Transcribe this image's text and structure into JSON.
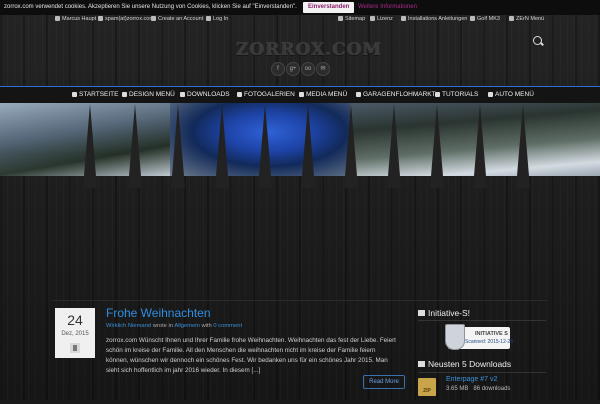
{
  "cookie": {
    "message": "zorrox.com verwendet cookies. Akzeptieren Sie unsere Nutzung von Cookies, klicken Sie auf \"Einverstanden\".",
    "accept_label": "Einverstanden",
    "more_label": "Weitere Informationen"
  },
  "topbar": {
    "user": "Marcus Haupt",
    "email": "spam(at)zorrox.com",
    "create_account": "Create an Account",
    "login": "Log In",
    "sitemap": "Sitemap",
    "license": "Lizenz",
    "install": "Installations Anleitungen",
    "golf": "Golf MK3",
    "zern": "ZErN Menü"
  },
  "logo": "ZORROX.COM",
  "social": [
    "f",
    "g+",
    "oo",
    "✉"
  ],
  "nav": {
    "items": [
      "STARTSEITE",
      "DESIGN MENÜ",
      "DOWNLOADS",
      "FOTOGALERIEN",
      "MEDIA MENÜ",
      "GARAGENFLOHMARKT",
      "TUTORIALS",
      "AUTO MENÜ"
    ],
    "accent": "#2f6fd8"
  },
  "post": {
    "day": "24",
    "month": "Dez, 2015",
    "title": "Frohe Weihnachten",
    "author": "Wirklich Niemand",
    "wrote_in": "wrote in",
    "category": "Allgemein",
    "with": "with",
    "comments": "0 comment",
    "body": "zorrox.com Wünscht Ihnen und Ihrer Familie frohe Weihnachten. Weihnachten das fest der Liebe. Feiert schön im kreise der Familie. All den Menschen die weihnachten nicht im kreise der Familie feiern können, wünschen wir dennoch ein schönes Fest. Wir bedanken uns für ein schönes Jahr 2015. Man sieht sich hoffentlich im jahr 2016 wieder. In diesem [...]",
    "read_more": "Read More"
  },
  "sidebar": {
    "initiative_title": "Initiative-S!",
    "badge_line1": "INITIATIVE S",
    "badge_line2": "Scanned: 2015-12-25",
    "downloads_title": "Neusten 5 Downloads",
    "download": {
      "name": "Enterpage #7 v2",
      "size": "3.65 MB",
      "count": "86 downloads",
      "icon_text": "ZIP"
    }
  }
}
